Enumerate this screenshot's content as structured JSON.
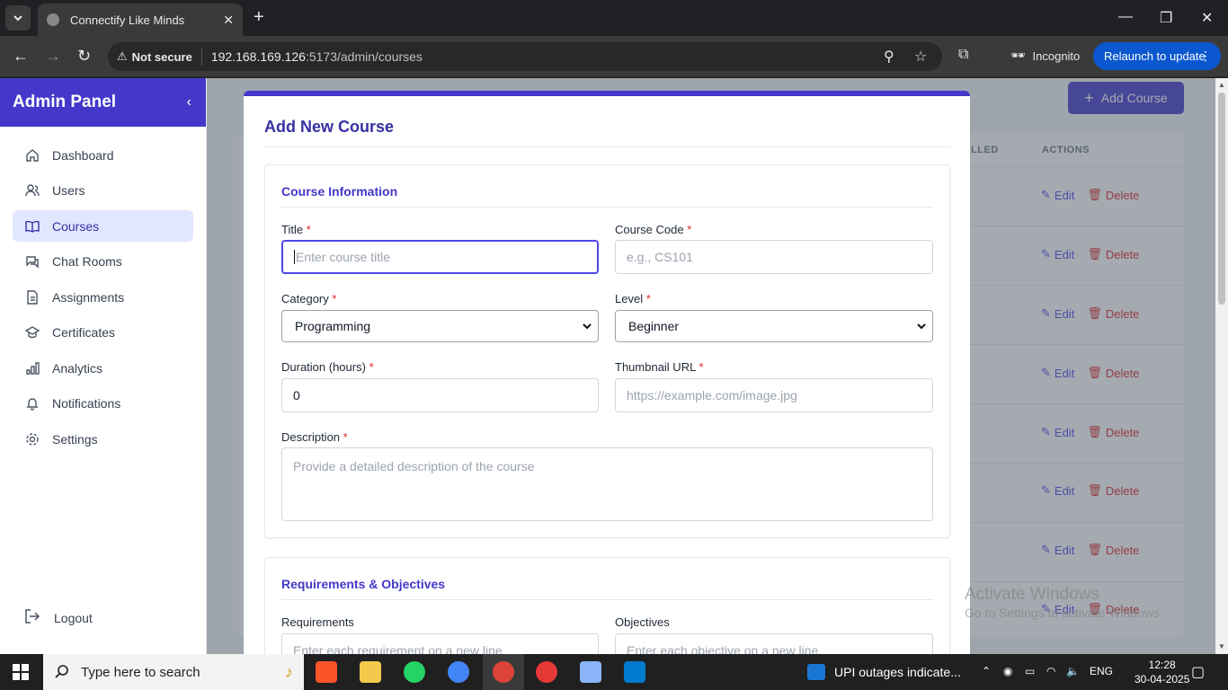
{
  "browser": {
    "tab_title": "Connectify Like Minds",
    "security_label": "Not secure",
    "url_host": "192.168.169.126",
    "url_rest": ":5173/admin/courses",
    "incognito_label": "Incognito",
    "relaunch_label": "Relaunch to update"
  },
  "sidebar": {
    "title": "Admin Panel",
    "items": [
      {
        "label": "Dashboard",
        "icon": "home-icon"
      },
      {
        "label": "Users",
        "icon": "users-icon"
      },
      {
        "label": "Courses",
        "icon": "book-icon",
        "active": true
      },
      {
        "label": "Chat Rooms",
        "icon": "chat-icon"
      },
      {
        "label": "Assignments",
        "icon": "document-icon"
      },
      {
        "label": "Certificates",
        "icon": "graduation-icon"
      },
      {
        "label": "Analytics",
        "icon": "bar-chart-icon"
      },
      {
        "label": "Notifications",
        "icon": "bell-icon"
      },
      {
        "label": "Settings",
        "icon": "gear-icon"
      }
    ],
    "logout": "Logout"
  },
  "header": {
    "add_course": "Add Course"
  },
  "table": {
    "headers": [
      "LLED",
      "ACTIONS"
    ],
    "edit_label": "Edit",
    "delete_label": "Delete"
  },
  "modal": {
    "title": "Add New Course",
    "course_info": {
      "section_title": "Course Information",
      "title_label": "Title",
      "title_placeholder": "Enter course title",
      "code_label": "Course Code",
      "code_placeholder": "e.g., CS101",
      "category_label": "Category",
      "category_value": "Programming",
      "level_label": "Level",
      "level_value": "Beginner",
      "duration_label": "Duration (hours)",
      "duration_value": "0",
      "thumbnail_label": "Thumbnail URL",
      "thumbnail_placeholder": "https://example.com/image.jpg",
      "description_label": "Description",
      "description_placeholder": "Provide a detailed description of the course"
    },
    "requirements": {
      "section_title": "Requirements & Objectives",
      "requirements_label": "Requirements",
      "requirements_placeholder": "Enter each requirement on a new line",
      "objectives_label": "Objectives",
      "objectives_placeholder": "Enter each objective on a new line"
    }
  },
  "watermark": {
    "line1": "Activate Windows",
    "line2": "Go to Settings to activate Windows."
  },
  "taskbar": {
    "search_placeholder": "Type here to search",
    "news": "UPI outages indicate...",
    "lang": "ENG",
    "time": "12:28",
    "date": "30-04-2025"
  },
  "colors": {
    "accent": "#4338ca",
    "danger": "#dc2626",
    "link": "#4f46e5"
  }
}
